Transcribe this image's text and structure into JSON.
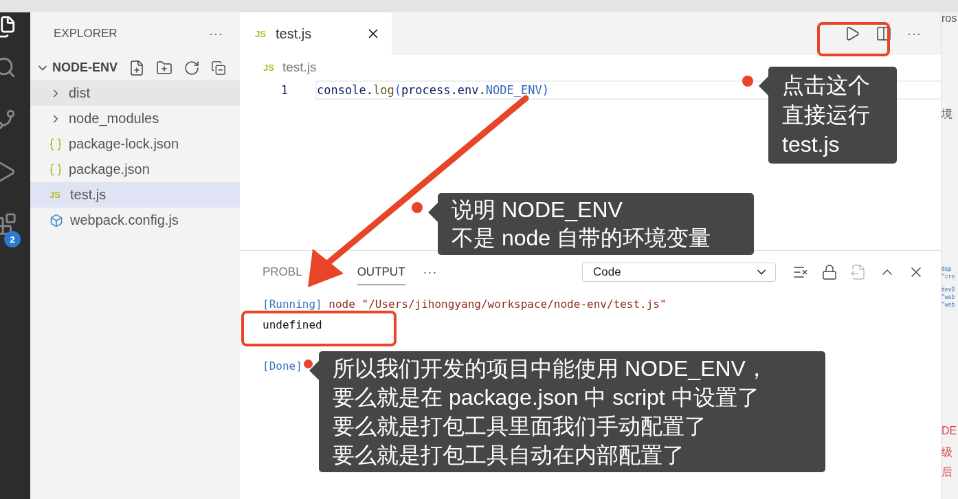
{
  "activity_bar": {
    "items": [
      {
        "kind": "files",
        "selected": true
      },
      {
        "kind": "search",
        "selected": false
      },
      {
        "kind": "git",
        "selected": false
      },
      {
        "kind": "run",
        "selected": false
      },
      {
        "kind": "extensions",
        "selected": false,
        "badge": "2"
      }
    ]
  },
  "sidebar": {
    "title": "EXPLORER",
    "more": "···",
    "folder": {
      "name": "NODE-ENV",
      "expanded": true
    },
    "items": [
      {
        "name": "dist",
        "kind": "folder",
        "selected": false,
        "hovered": true
      },
      {
        "name": "node_modules",
        "kind": "folder",
        "selected": false
      },
      {
        "name": "package-lock.json",
        "kind": "json",
        "selected": false
      },
      {
        "name": "package.json",
        "kind": "json",
        "selected": false
      },
      {
        "name": "test.js",
        "kind": "js",
        "icon": "JS",
        "selected": true
      },
      {
        "name": "webpack.config.js",
        "kind": "webpack",
        "selected": false
      }
    ]
  },
  "editor": {
    "tabs": [
      {
        "label": "test.js",
        "icon": "JS",
        "selected": true
      }
    ],
    "more": "···",
    "breadcrumb": {
      "icon": "JS",
      "label": "test.js"
    },
    "lines": [
      {
        "number": "1",
        "tokens": [
          {
            "text": "console",
            "kind": "var"
          },
          {
            "text": ".",
            "kind": "punct"
          },
          {
            "text": "log",
            "kind": "fn"
          },
          {
            "text": "(",
            "kind": "paren"
          },
          {
            "text": "process",
            "kind": "var"
          },
          {
            "text": ".",
            "kind": "punct"
          },
          {
            "text": "env",
            "kind": "var"
          },
          {
            "text": ".",
            "kind": "punct"
          },
          {
            "text": "NODE_ENV",
            "kind": "const"
          },
          {
            "text": ")",
            "kind": "paren"
          }
        ]
      }
    ]
  },
  "panel": {
    "tabs": [
      {
        "label": "PROBL",
        "selected": false
      },
      {
        "label": "OUTPUT",
        "selected": true
      }
    ],
    "more": "···",
    "channel": "Code",
    "output": [
      {
        "tag": "[Running]",
        "text": " node \"/Users/jihongyang/workspace/node-env/test.js\""
      },
      {
        "text": "undefined"
      },
      {
        "tag": "[Done]"
      }
    ]
  },
  "background_window": {
    "fragments": [
      {
        "text": "ros",
        "kind": "title"
      },
      {
        "text": "境",
        "kind": "plain"
      },
      {
        "text": "dep",
        "kind": "code"
      },
      {
        "text": "\"cro",
        "kind": "code"
      },
      {
        "text": "devD",
        "kind": "code"
      },
      {
        "text": "\"web",
        "kind": "code"
      },
      {
        "text": "\"web",
        "kind": "code"
      },
      {
        "text": "DE",
        "kind": "red"
      },
      {
        "text": "级",
        "kind": "red"
      },
      {
        "text": "后",
        "kind": "red"
      }
    ]
  },
  "annotations": {
    "callouts": [
      {
        "lines": [
          "点击这个",
          "直接运行",
          "test.js"
        ]
      },
      {
        "lines": [
          "说明 NODE_ENV",
          "不是 node 自带的环境变量"
        ]
      },
      {
        "lines": [
          "所以我们开发的项目中能使用 NODE_ENV，",
          "要么就是在 package.json 中 script 中设置了",
          "要么就是打包工具里面我们手动配置了",
          "要么就是打包工具自动在内部配置了"
        ]
      }
    ]
  }
}
